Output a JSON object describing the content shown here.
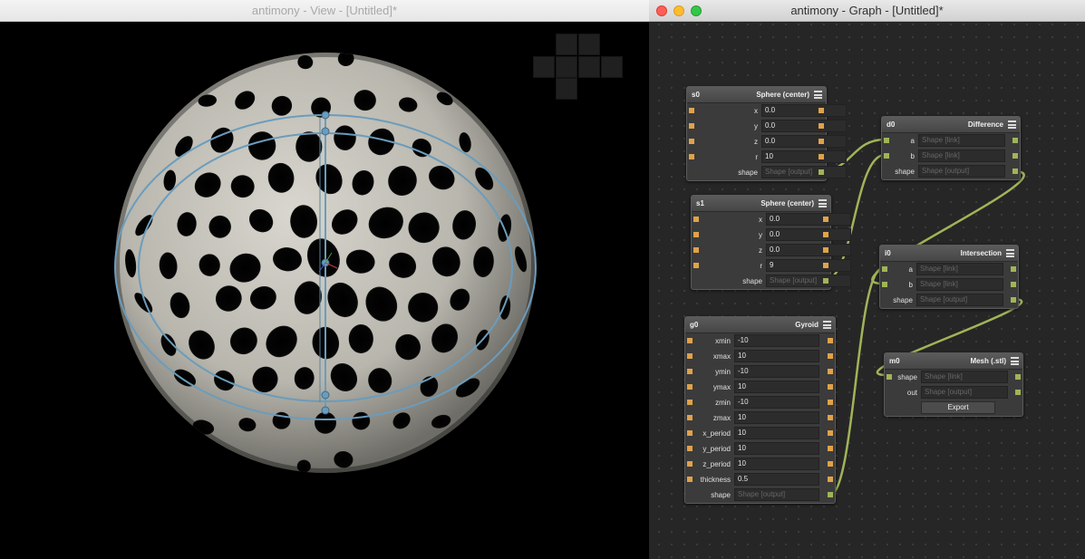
{
  "view": {
    "title": "antimony - View - [Untitled]*"
  },
  "graph": {
    "title": "antimony - Graph - [Untitled]*",
    "wire_color": "#a0b458",
    "port_color": "#e0a24a",
    "nodes": {
      "s0": {
        "name": "s0",
        "type": "Sphere (center)",
        "rows": [
          {
            "label": "x",
            "value": "0.0"
          },
          {
            "label": "y",
            "value": "0.0"
          },
          {
            "label": "z",
            "value": "0.0"
          },
          {
            "label": "r",
            "value": "10"
          },
          {
            "label": "shape",
            "value": "Shape [output]"
          }
        ]
      },
      "s1": {
        "name": "s1",
        "type": "Sphere (center)",
        "rows": [
          {
            "label": "x",
            "value": "0.0"
          },
          {
            "label": "y",
            "value": "0.0"
          },
          {
            "label": "z",
            "value": "0.0"
          },
          {
            "label": "r",
            "value": "9"
          },
          {
            "label": "shape",
            "value": "Shape [output]"
          }
        ]
      },
      "d0": {
        "name": "d0",
        "type": "Difference",
        "rows": [
          {
            "label": "a",
            "value": "Shape [link]"
          },
          {
            "label": "b",
            "value": "Shape [link]"
          },
          {
            "label": "shape",
            "value": "Shape [output]"
          }
        ]
      },
      "i0": {
        "name": "i0",
        "type": "Intersection",
        "rows": [
          {
            "label": "a",
            "value": "Shape [link]"
          },
          {
            "label": "b",
            "value": "Shape [link]"
          },
          {
            "label": "shape",
            "value": "Shape [output]"
          }
        ]
      },
      "m0": {
        "name": "m0",
        "type": "Mesh (.stl)",
        "rows": [
          {
            "label": "shape",
            "value": "Shape [link]"
          },
          {
            "label": "out",
            "value": "Shape [output]"
          }
        ],
        "export_label": "Export"
      },
      "g0": {
        "name": "g0",
        "type": "Gyroid",
        "rows": [
          {
            "label": "xmin",
            "value": "-10"
          },
          {
            "label": "xmax",
            "value": "10"
          },
          {
            "label": "ymin",
            "value": "-10"
          },
          {
            "label": "ymax",
            "value": "10"
          },
          {
            "label": "zmin",
            "value": "-10"
          },
          {
            "label": "zmax",
            "value": "10"
          },
          {
            "label": "x_period",
            "value": "10"
          },
          {
            "label": "y_period",
            "value": "10"
          },
          {
            "label": "z_period",
            "value": "10"
          },
          {
            "label": "thickness",
            "value": "0.5"
          },
          {
            "label": "shape",
            "value": "Shape [output]"
          }
        ]
      }
    }
  }
}
